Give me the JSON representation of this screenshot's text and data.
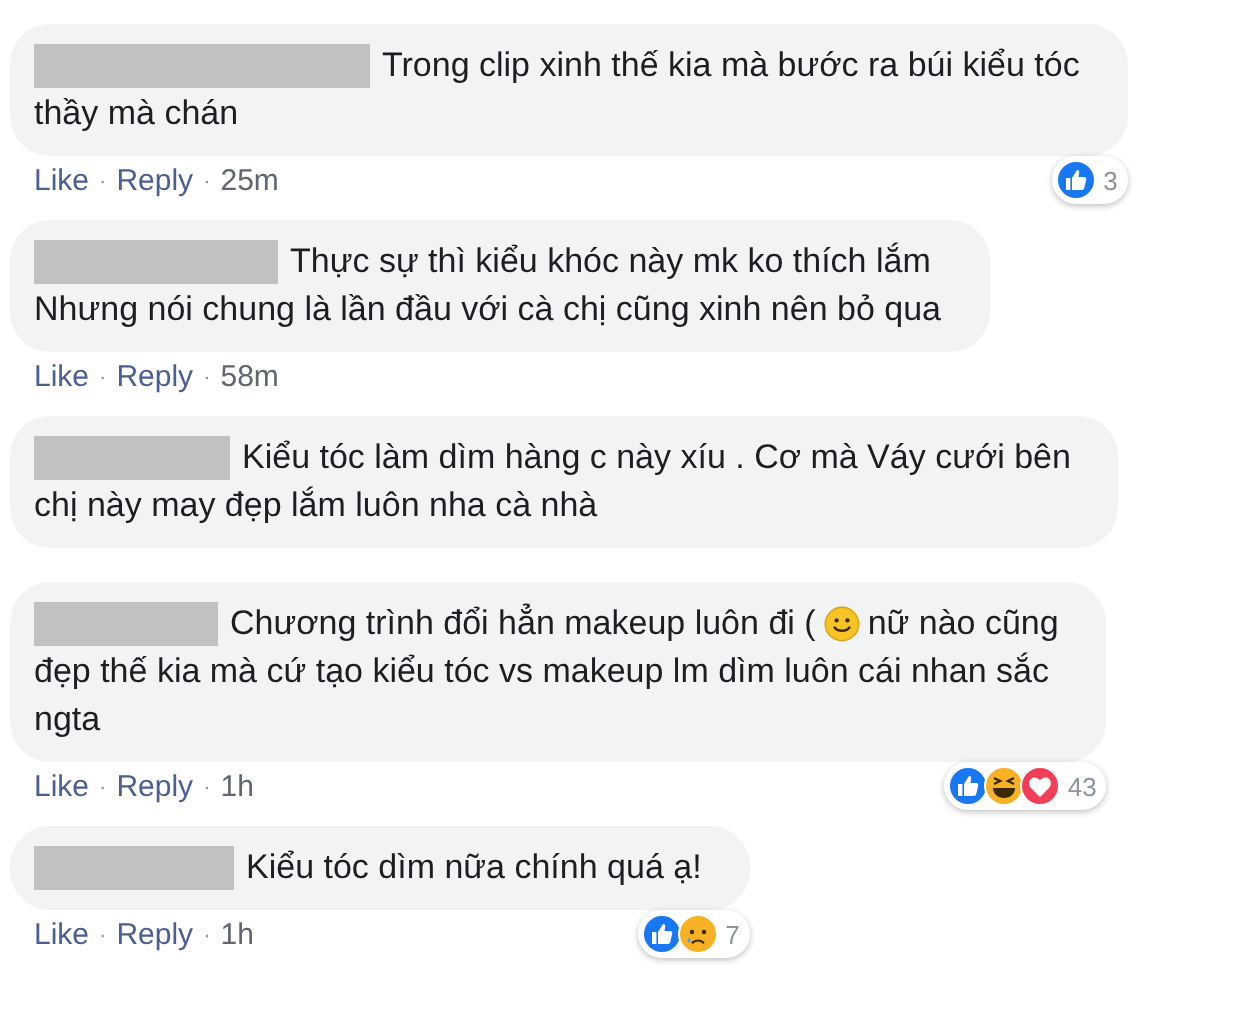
{
  "comments": [
    {
      "head": [
        {
          "kind": "text",
          "text": "Trong clip xinh thế kia mà bước ra búi kiểu tóc"
        }
      ],
      "body": "thầy mà chán",
      "actions": [
        {
          "kind": "link",
          "text": "Like"
        },
        {
          "kind": "dot",
          "text": "·"
        },
        {
          "kind": "link",
          "text": "Reply"
        },
        {
          "kind": "dot",
          "text": "·"
        },
        {
          "kind": "time",
          "text": "25m"
        }
      ],
      "reactions": {
        "like": true,
        "count": "3"
      }
    },
    {
      "head": [
        {
          "kind": "text",
          "text": "Thực sự thì kiểu khóc này mk ko thích lắm"
        }
      ],
      "body": "Nhưng nói chung là lần đầu với cà chị cũng xinh nên bỏ qua",
      "actions": [
        {
          "kind": "link",
          "text": "Like"
        },
        {
          "kind": "dot",
          "text": "·"
        },
        {
          "kind": "link",
          "text": "Reply"
        },
        {
          "kind": "dot",
          "text": "·"
        },
        {
          "kind": "time",
          "text": "58m"
        }
      ]
    },
    {
      "head": [
        {
          "kind": "text",
          "text": "Kiểu tóc làm dìm hàng c này xíu . Cơ mà Váy cưới bên"
        }
      ],
      "body": "chị này may đẹp lắm luôn nha cà nhà"
    },
    {
      "head": [
        {
          "kind": "text",
          "text": "Chương trình đổi hẳn makeup luôn đi ("
        },
        {
          "kind": "emoji"
        },
        {
          "kind": "text",
          "text": "nữ nào cũng"
        }
      ],
      "body": "đẹp thế kia mà cứ tạo kiểu tóc vs makeup lm dìm luôn cái nhan sắc\nngta",
      "actions": [
        {
          "kind": "link",
          "text": "Like"
        },
        {
          "kind": "dot",
          "text": "·"
        },
        {
          "kind": "link",
          "text": "Reply"
        },
        {
          "kind": "dot",
          "text": "·"
        },
        {
          "kind": "time",
          "text": "1h"
        }
      ],
      "reactions": {
        "like": true,
        "haha": true,
        "love": true,
        "count": "43"
      }
    },
    {
      "head": [
        {
          "kind": "text",
          "text": "Kiểu tóc dìm nữa chính quá ạ!"
        }
      ],
      "actions": [
        {
          "kind": "link",
          "text": "Like"
        },
        {
          "kind": "dot",
          "text": "·"
        },
        {
          "kind": "link",
          "text": "Reply"
        },
        {
          "kind": "dot",
          "text": "·"
        },
        {
          "kind": "time",
          "text": "1h"
        }
      ],
      "reactions": {
        "like": true,
        "sad": true,
        "count": "7"
      }
    }
  ]
}
